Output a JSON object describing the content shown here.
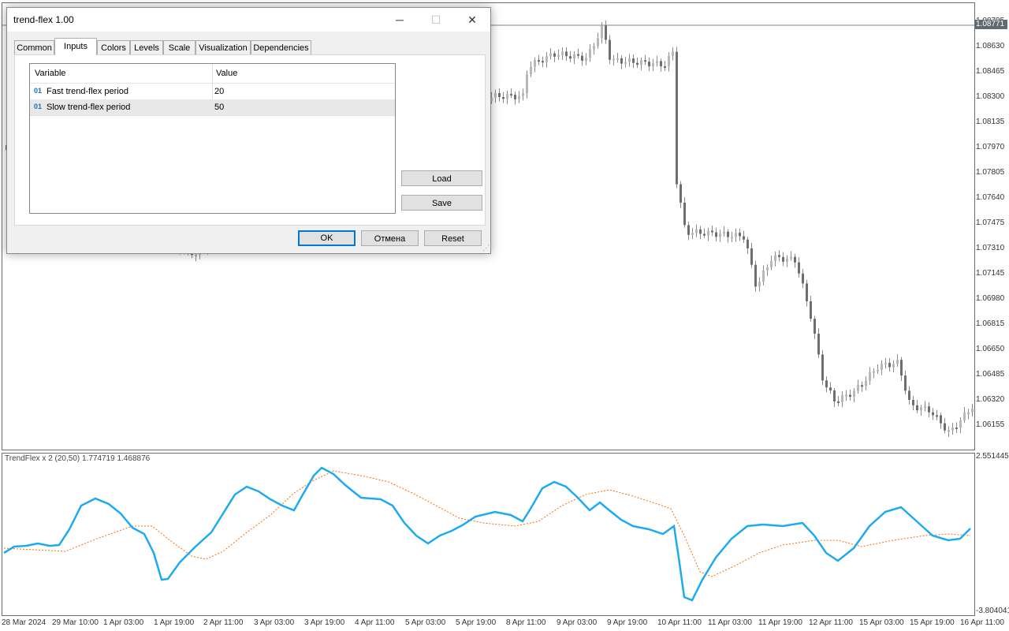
{
  "dialog": {
    "title": "trend-flex 1.00",
    "minimize_glyph": "─",
    "maximize_glyph": "☐",
    "close_glyph": "✕",
    "tabs": [
      {
        "label": "Common"
      },
      {
        "label": "Inputs"
      },
      {
        "label": "Colors"
      },
      {
        "label": "Levels"
      },
      {
        "label": "Scale"
      },
      {
        "label": "Visualization"
      },
      {
        "label": "Dependencies"
      }
    ],
    "active_tab": "Inputs",
    "grid": {
      "col_variable": "Variable",
      "col_value": "Value",
      "rows": [
        {
          "type": "01",
          "variable": "Fast trend-flex period",
          "value": "20"
        },
        {
          "type": "01",
          "variable": "Slow trend-flex period",
          "value": "50"
        }
      ]
    },
    "load_label": "Load",
    "save_label": "Save",
    "ok_label": "OK",
    "cancel_label": "Отмена",
    "reset_label": "Reset"
  },
  "price_axis": {
    "current": "1.08771",
    "labels": [
      "1.08795",
      "1.08630",
      "1.08465",
      "1.08300",
      "1.08135",
      "1.07970",
      "1.07805",
      "1.07640",
      "1.07475",
      "1.07310",
      "1.07145",
      "1.06980",
      "1.06815",
      "1.06650",
      "1.06485",
      "1.06320",
      "1.06155"
    ]
  },
  "indicator": {
    "title": "TrendFlex x 2 (20,50) 1.774719 1.468876",
    "max_label": "2.551445",
    "min_label": "-3.804041",
    "fast_color": "#1eaaf1",
    "slow_color": "#ff6a00"
  },
  "time_axis": {
    "labels": [
      "28 Mar 2024",
      "29 Mar 10:00",
      "1 Apr 03:00",
      "1 Apr 19:00",
      "2 Apr 11:00",
      "3 Apr 03:00",
      "3 Apr 19:00",
      "4 Apr 11:00",
      "5 Apr 03:00",
      "5 Apr 19:00",
      "8 Apr 11:00",
      "9 Apr 03:00",
      "9 Apr 19:00",
      "10 Apr 11:00",
      "11 Apr 03:00",
      "11 Apr 19:00",
      "12 Apr 11:00",
      "15 Apr 03:00",
      "15 Apr 19:00",
      "16 Apr 11:00"
    ]
  }
}
